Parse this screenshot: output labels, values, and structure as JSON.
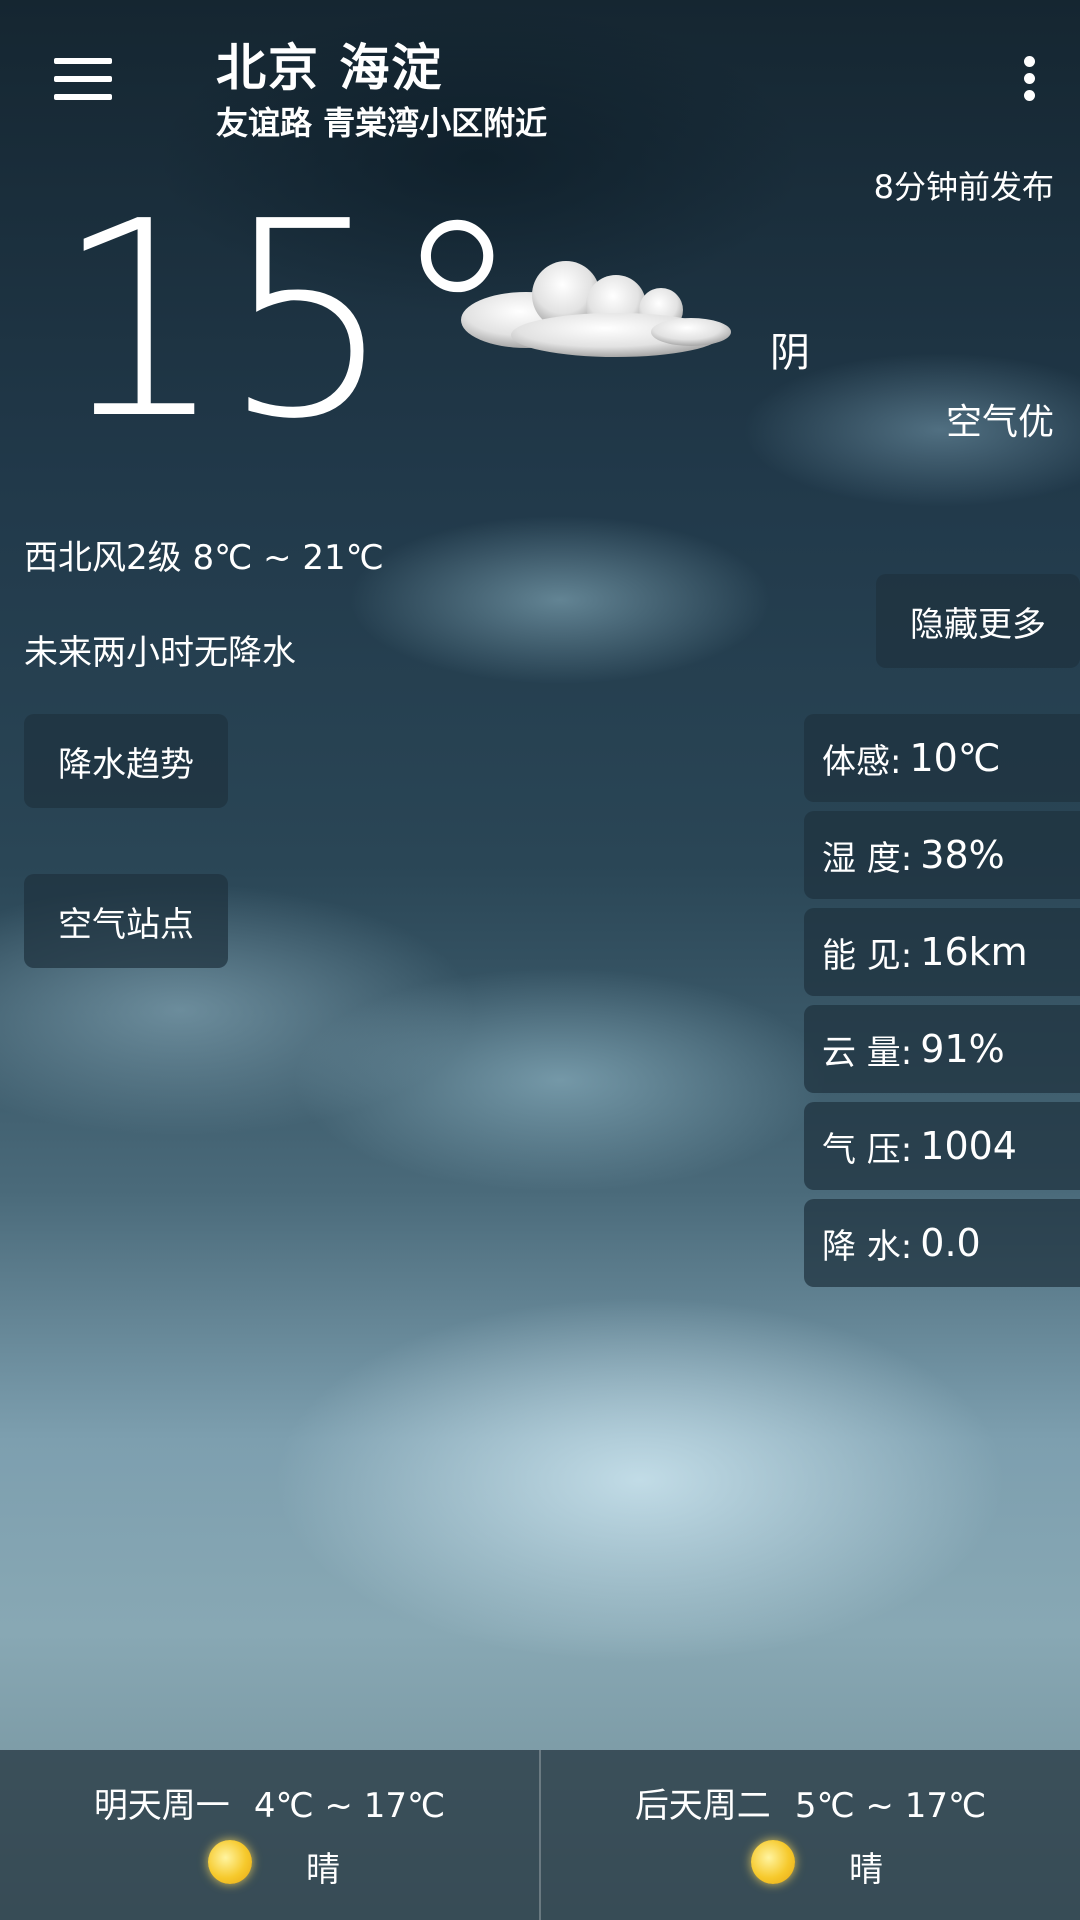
{
  "header": {
    "city": "北京 海淀",
    "street": "友谊路 青棠湾小区附近",
    "published": "8分钟前发布",
    "menu_icon": "hamburger-menu-icon",
    "more_icon": "more-vertical-icon"
  },
  "current": {
    "temperature": "15°",
    "condition": "阴",
    "condition_icon": "cloud-icon",
    "air_quality": "空气优",
    "wind_range": "西北风2级   8℃ ~ 21℃",
    "rain_forecast": "未来两小时无降水"
  },
  "buttons": {
    "hide_more": "隐藏更多",
    "rain_trend": "降水趋势",
    "air_station": "空气站点"
  },
  "metrics": [
    {
      "label": "体感:",
      "value": "10℃"
    },
    {
      "label": "湿 度:",
      "value": "38%"
    },
    {
      "label": "能 见:",
      "value": "16km"
    },
    {
      "label": "云 量:",
      "value": "91%"
    },
    {
      "label": "气 压:",
      "value": "1004"
    },
    {
      "label": "降 水:",
      "value": "0.0"
    }
  ],
  "forecast": [
    {
      "day": "明天周一",
      "range": "4℃ ~ 17℃",
      "condition": "晴",
      "icon": "sun-icon"
    },
    {
      "day": "后天周二",
      "range": "5℃ ~ 17℃",
      "condition": "晴",
      "icon": "sun-icon"
    }
  ]
}
